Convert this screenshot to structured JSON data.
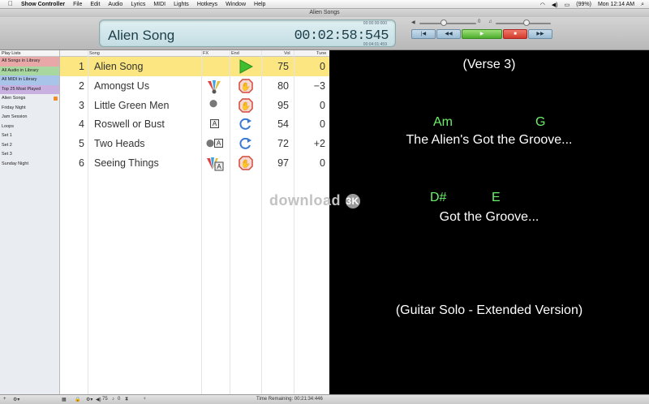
{
  "menubar": {
    "app_name": "Show Controller",
    "items": [
      "File",
      "Edit",
      "Audio",
      "Lyrics",
      "MIDI",
      "Lights",
      "Hotkeys",
      "Window",
      "Help"
    ],
    "battery": "(99%)",
    "clock": "Mon 12:14 AM"
  },
  "window": {
    "title": "Alien Songs"
  },
  "display": {
    "song_title": "Alien Song",
    "time": "00:02:58:545",
    "elapsed": "00:00:00:000",
    "total": "00:04:01:459"
  },
  "transport": {
    "slider_a": "0",
    "slider_b": "0",
    "buttons": [
      "|◀",
      "◀◀",
      "▶",
      "■",
      "▶▶"
    ]
  },
  "sidebar": {
    "header": "Play Lists",
    "items": [
      {
        "label": "All Songs in Library",
        "color": "red"
      },
      {
        "label": "All Audio in Library",
        "color": "green"
      },
      {
        "label": "All MIDI in Library",
        "color": "blue"
      },
      {
        "label": "Top 25 Most Played",
        "color": "purple"
      },
      {
        "label": "Alien Songs",
        "color": "",
        "badge": true
      },
      {
        "label": "Friday Night",
        "color": ""
      },
      {
        "label": "Jam Session",
        "color": ""
      },
      {
        "label": "Loops",
        "color": ""
      },
      {
        "label": "Set 1",
        "color": ""
      },
      {
        "label": "Set 2",
        "color": ""
      },
      {
        "label": "Set 3",
        "color": ""
      },
      {
        "label": "Sunday Night",
        "color": ""
      }
    ]
  },
  "songlist": {
    "columns": {
      "song": "Song",
      "fx": "FX",
      "end": "End",
      "vol": "Vol",
      "tune": "Tune"
    },
    "rows": [
      {
        "num": "1",
        "song": "Alien Song",
        "fx": "",
        "end": "play-icon",
        "vol": "75",
        "tune": "0"
      },
      {
        "num": "2",
        "song": "Amongst Us",
        "fx": "lights-icon",
        "end": "stop-hand-icon",
        "vol": "80",
        "tune": "−3"
      },
      {
        "num": "3",
        "song": "Little Green Men",
        "fx": "dots-icon",
        "end": "stop-hand-icon",
        "vol": "95",
        "tune": "0"
      },
      {
        "num": "4",
        "song": "Roswell or Bust",
        "fx": "A",
        "end": "loop-icon",
        "vol": "54",
        "tune": "0"
      },
      {
        "num": "5",
        "song": "Two Heads",
        "fx": "dots-A",
        "end": "loop-icon",
        "vol": "72",
        "tune": "+2"
      },
      {
        "num": "6",
        "song": "Seeing Things",
        "fx": "lights-A",
        "end": "stop-hand-icon",
        "vol": "97",
        "tune": "0"
      }
    ]
  },
  "lyrics": {
    "heading": "(Verse 3)",
    "chords1": [
      "Am",
      "G"
    ],
    "line1": "The Alien's Got the Groove...",
    "chords2": [
      "D#",
      "E"
    ],
    "line2": "Got the Groove...",
    "footer": "(Guitar Solo - Extended Version)"
  },
  "watermark": {
    "text": "download",
    "mark": "3K"
  },
  "status": {
    "vol": "75",
    "pitch": "0",
    "time_remaining": "Time Remaining: 00:21:34:446"
  },
  "colors": {
    "selected_row": "#fbe681",
    "chord": "#6cf06c",
    "lyrics_bg": "#000000"
  }
}
